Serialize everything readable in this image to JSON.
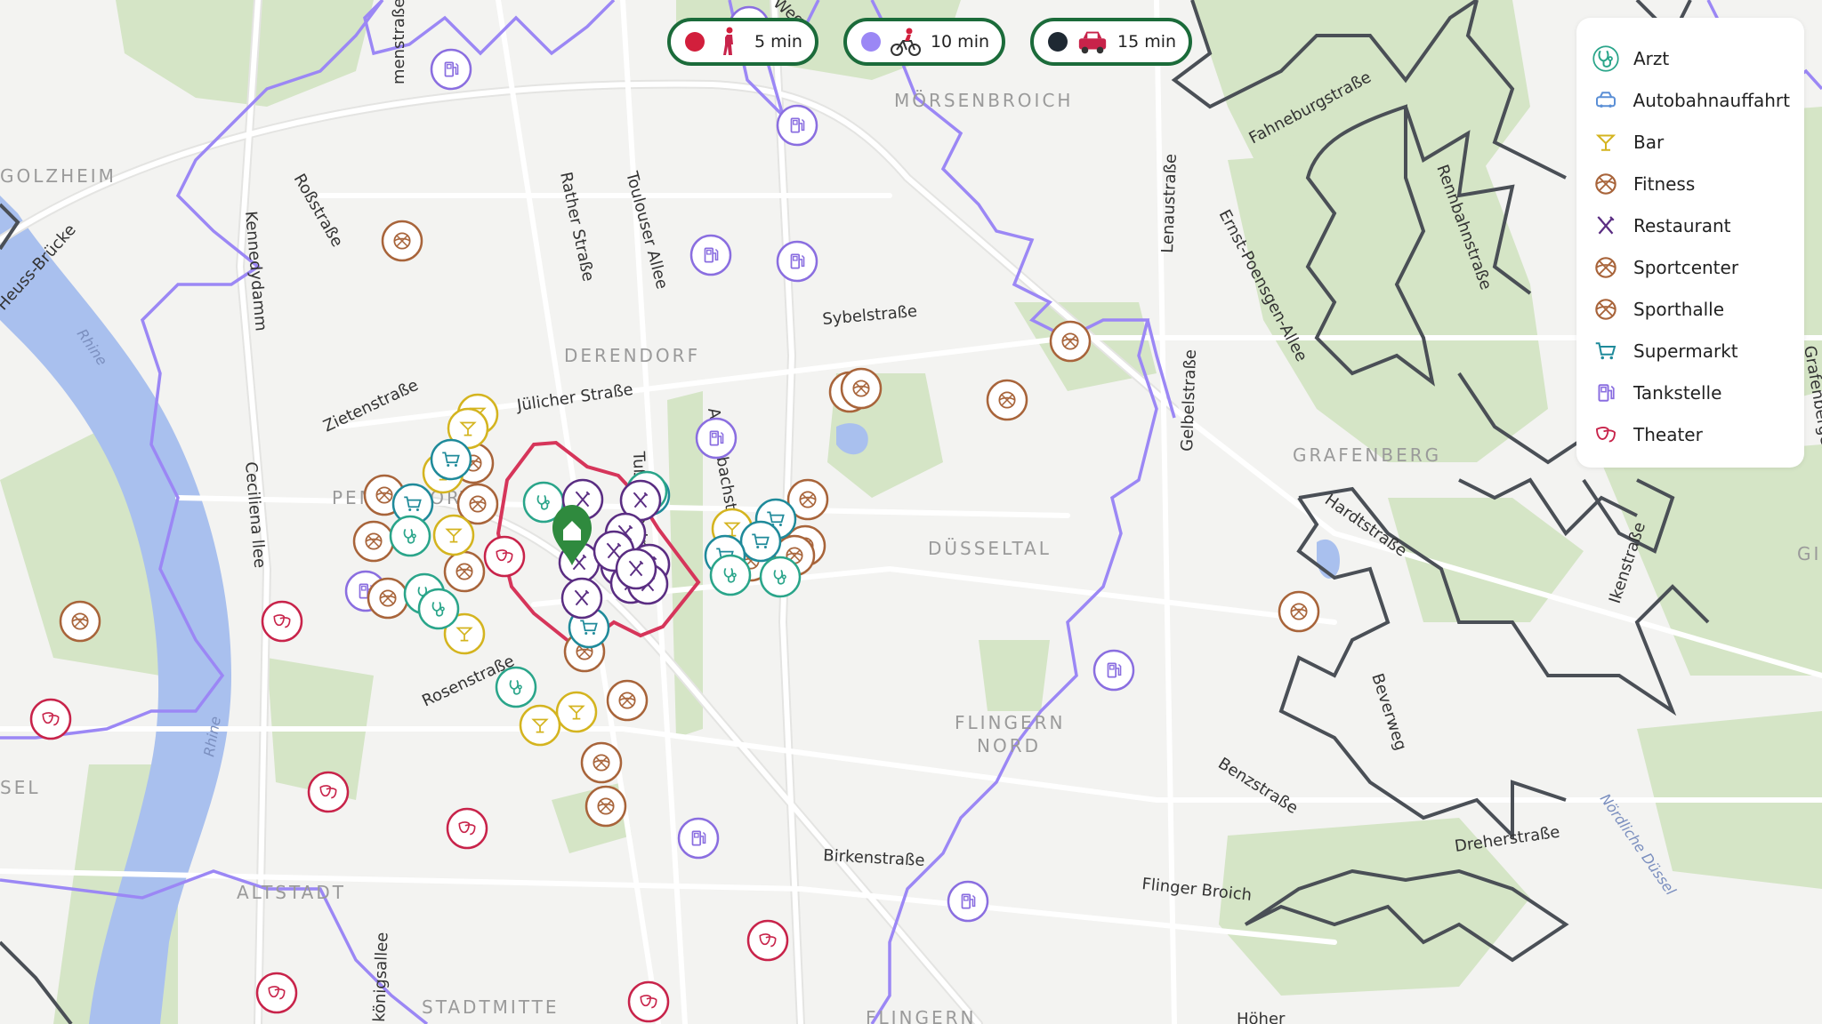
{
  "travel_modes": [
    {
      "mode": "walk",
      "label": "5 min",
      "color": "#d21f3c",
      "icon": "walking-person-icon"
    },
    {
      "mode": "bike",
      "label": "10 min",
      "color": "#9b87f5",
      "icon": "bicycle-icon"
    },
    {
      "mode": "car",
      "label": "15 min",
      "color": "#1f2933",
      "icon": "car-icon"
    }
  ],
  "legend": [
    {
      "label": "Arzt",
      "icon": "doctor-stethoscope-icon",
      "color": "#2aa58a"
    },
    {
      "label": "Autobahnauffahrt",
      "icon": "highway-car-icon",
      "color": "#5b8fd6"
    },
    {
      "label": "Bar",
      "icon": "cocktail-glass-icon",
      "color": "#d4b41f"
    },
    {
      "label": "Fitness",
      "icon": "ball-icon",
      "color": "#a8643a"
    },
    {
      "label": "Restaurant",
      "icon": "fork-knife-icon",
      "color": "#5a2d82"
    },
    {
      "label": "Sportcenter",
      "icon": "ball-icon",
      "color": "#a8643a"
    },
    {
      "label": "Sporthalle",
      "icon": "ball-icon",
      "color": "#a8643a"
    },
    {
      "label": "Supermarkt",
      "icon": "shopping-cart-icon",
      "color": "#1f8a9a"
    },
    {
      "label": "Tankstelle",
      "icon": "fuel-pump-icon",
      "color": "#8a6ee0"
    },
    {
      "label": "Theater",
      "icon": "theater-masks-icon",
      "color": "#c8234a"
    }
  ],
  "places": [
    "GOLZHEIM",
    "MÖRSENBROICH",
    "DERENDORF",
    "PEMPELFORT",
    "DÜSSELTAL",
    "GRAFENBERG",
    "FLINGERN",
    "NORD",
    "ALTSTADT",
    "STADTMITTE",
    "FLINGERN",
    "SEL",
    "GI"
  ],
  "streets": [
    "menstraße",
    "Roßstraße",
    "Kennedydamm",
    "Rather Straße",
    "Toulouser Allee",
    "Sybelstraße",
    "Lenaustraße",
    "Fahneburgstraße",
    "Rennbahnstraße",
    "Ernst-Poensgen-Allee",
    "Jülicher Straße",
    "Zietenstraße",
    "Ceciliena llee",
    "Heuss-Brücke",
    "Tußmannstraße",
    "Achenbachstraße",
    "Gelbelstraße",
    "Hardtstraße",
    "Ikenstraße",
    "Beverweg",
    "Rosenstraße",
    "Benzstraße",
    "Dreherstraße",
    "Birkenstraße",
    "Flinger Broich",
    "königsallee",
    "Höher",
    "Nördliche Düssel",
    "Rhine",
    "Rhine",
    "Weg",
    "Grafenberger"
  ],
  "home_marker": {
    "icon": "home-icon",
    "color": "#2f8a3e"
  }
}
